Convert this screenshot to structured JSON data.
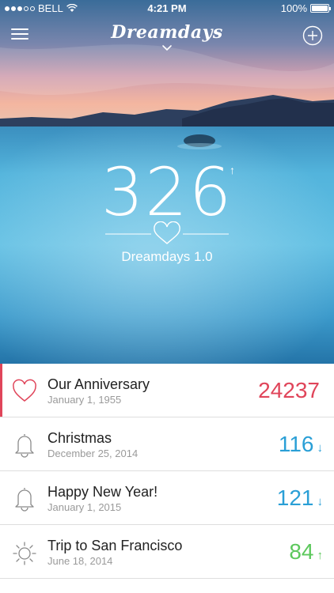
{
  "status_bar": {
    "carrier": "BELL",
    "time": "4:21 PM",
    "battery": "100%"
  },
  "nav": {
    "title": "Dreamdays",
    "menu_icon": "hamburger-menu-icon",
    "add_icon": "plus-circle-icon",
    "chevron_icon": "chevron-down-icon"
  },
  "featured": {
    "days": "326",
    "direction": "↑",
    "icon": "heart-icon",
    "title": "Dreamdays 1.0"
  },
  "colors": {
    "pink": "#e0455a",
    "blue": "#2a9fd6",
    "green": "#5cc85c"
  },
  "events": [
    {
      "name": "Our Anniversary",
      "date": "January 1, 1955",
      "count": "24237",
      "arrow": "",
      "icon": "heart-icon",
      "color": "#e0455a"
    },
    {
      "name": "Christmas",
      "date": "December 25, 2014",
      "count": "116",
      "arrow": "↓",
      "icon": "bell-icon",
      "color": "#2a9fd6"
    },
    {
      "name": "Happy New Year!",
      "date": "January 1, 2015",
      "count": "121",
      "arrow": "↓",
      "icon": "bell-icon",
      "color": "#2a9fd6"
    },
    {
      "name": "Trip to San Francisco",
      "date": "June 18, 2014",
      "count": "84",
      "arrow": "↑",
      "icon": "sun-icon",
      "color": "#5cc85c"
    }
  ]
}
